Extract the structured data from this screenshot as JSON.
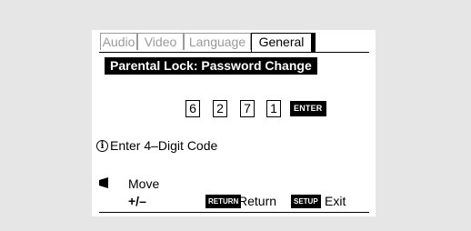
{
  "tabs": [
    {
      "label": "Audio",
      "active": false
    },
    {
      "label": "Video",
      "active": false
    },
    {
      "label": "Language",
      "active": false
    },
    {
      "label": "General",
      "active": true
    }
  ],
  "panel": {
    "title": "Parental Lock: Password Change",
    "digits": [
      "6",
      "2",
      "7",
      "1"
    ],
    "enter_label": "ENTER"
  },
  "info": {
    "icon": "info-icon",
    "text": "Enter 4–Digit Code"
  },
  "footer": {
    "move_icon": "left-arrow-icon",
    "move_label": "Move",
    "plusminus_label": "+/–",
    "return_badge": "RETURN",
    "return_label": "Return",
    "setup_badge": "SETUP",
    "exit_label": "Exit"
  },
  "colors": {
    "background": "#e6e6e6",
    "screen": "#ffffff",
    "inactive_tab_text": "#9a9a9a",
    "highlight": "#000000"
  }
}
